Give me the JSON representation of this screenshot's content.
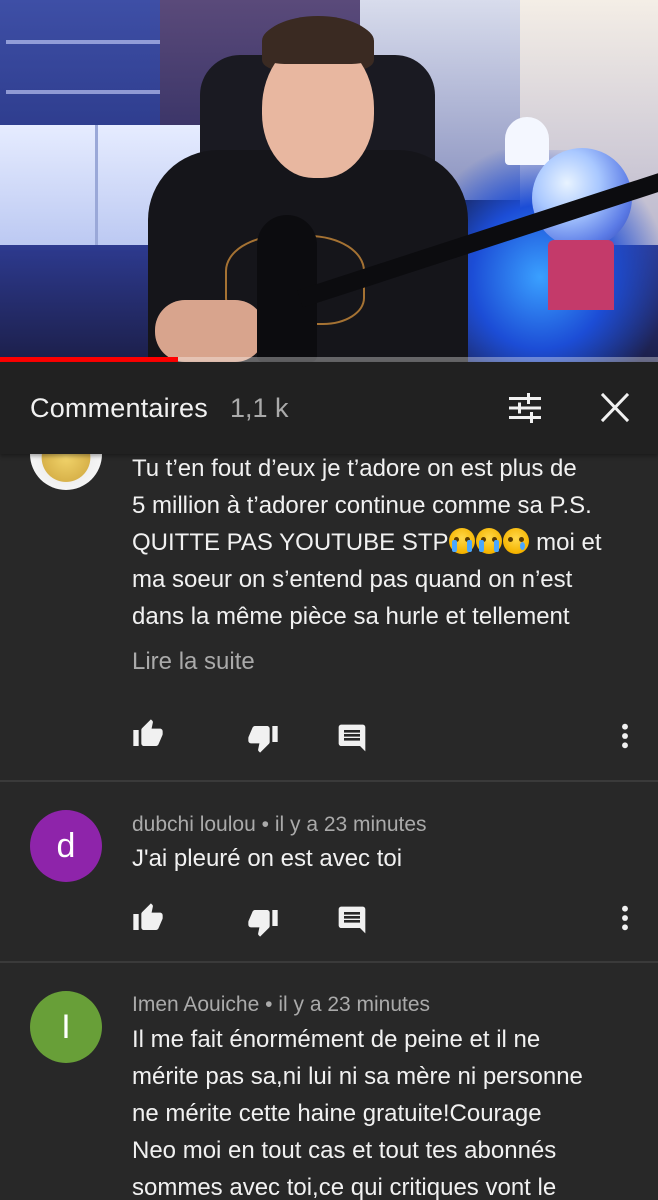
{
  "video": {
    "progress_fraction": 0.27
  },
  "comments_header": {
    "title": "Commentaires",
    "count": "1,1 k",
    "sort_icon": "sort-filter-icon",
    "close_icon": "close-icon"
  },
  "comments": [
    {
      "avatar_icon": "yellow-plush-avatar",
      "lines": [
        "Tu t’en fout d’eux je t’adore on est plus de",
        "5 million à t’adorer continue comme sa P.S.",
        "moi et",
        "ma soeur on s’entend pas quand on n’est",
        "dans la même pièce sa hurle et tellement"
      ],
      "line3_prefix": "QUITTE PAS YOUTUBE STP",
      "read_more": "Lire la suite"
    },
    {
      "avatar_letter": "d",
      "avatar_color": "#8e24aa",
      "author": "dubchi loulou",
      "time": "il y a 23 minutes",
      "separator": "•",
      "text": "J'ai pleuré on est avec toi"
    },
    {
      "avatar_letter": "I",
      "avatar_color": "#689f38",
      "author": "Imen Aouiche",
      "time": "il y a 23 minutes",
      "separator": "•",
      "lines": [
        "Il me fait énormément de peine et il ne",
        "mérite pas sa,ni lui ni sa mère ni personne",
        "ne mérite cette haine gratuite!Courage",
        "Neo moi en tout cas et tout tes abonnés",
        "sommes avec toi,ce qui critiques vont le"
      ]
    }
  ],
  "actions": {
    "like_icon": "thumb-up-icon",
    "dislike_icon": "thumb-down-icon",
    "reply_icon": "comment-reply-icon",
    "more_icon": "more-vertical-icon"
  },
  "colors": {
    "background": "#282828",
    "header_background": "#212121",
    "text_primary": "#f1f1f1",
    "text_secondary": "#aaaaaa",
    "progress": "#ff0000"
  }
}
